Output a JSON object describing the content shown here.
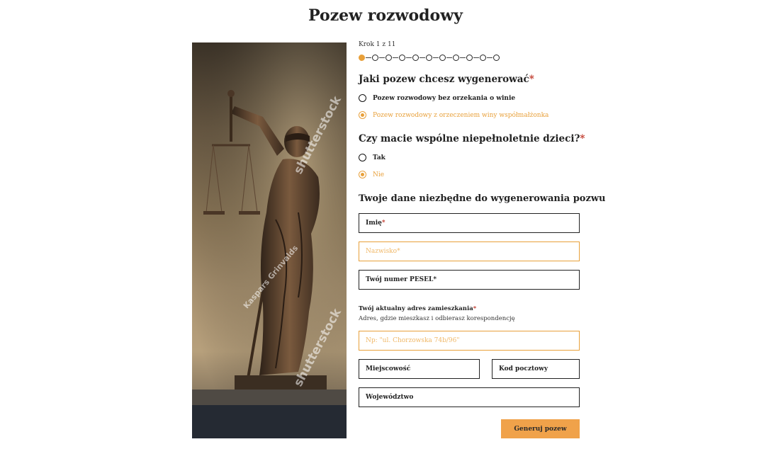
{
  "page": {
    "title": "Pozew rozwodowy"
  },
  "hero": {
    "watermark_brand": "shutterstock",
    "watermark_author": "Kaspars Grinvalds"
  },
  "progress": {
    "label": "Krok 1 z 11",
    "current": 1,
    "total": 11
  },
  "question1": {
    "label": "Jaki pozew chcesz wygenerować",
    "required_mark": "*",
    "options": [
      {
        "label": "Pozew rozwodowy bez orzekania o winie",
        "selected": false
      },
      {
        "label": "Pozew rozwodowy z orzeczeniem winy współmałżonka",
        "selected": true
      }
    ]
  },
  "question2": {
    "label": "Czy macie wspólne niepełnoletnie dzieci?",
    "required_mark": "*",
    "options": [
      {
        "label": "Tak",
        "selected": false
      },
      {
        "label": "Nie",
        "selected": true
      }
    ]
  },
  "personal": {
    "heading": "Twoje dane niezbędne do wygenerowania pozwu",
    "first_name": {
      "label": "Imię",
      "required_mark": "*"
    },
    "last_name": {
      "label": "Nazwisko",
      "required_mark": "*"
    },
    "pesel": {
      "label": "Twój numer PESEL*"
    }
  },
  "address": {
    "label": "Twój aktualny adres zamieszkania",
    "required_mark": "*",
    "help": "Adres, gdzie mieszkasz i odbierasz korespondencję",
    "street_placeholder": "Np: \"ul. Chorzowska 74b/96\"",
    "city_label": "Miejscowość",
    "postal_label": "Kod pocztowy",
    "region_label": "Województwo"
  },
  "submit": {
    "label": "Generuj pozew"
  },
  "colors": {
    "accent": "#e8a03a",
    "button": "#f0a24a",
    "required": "#c0392b"
  }
}
